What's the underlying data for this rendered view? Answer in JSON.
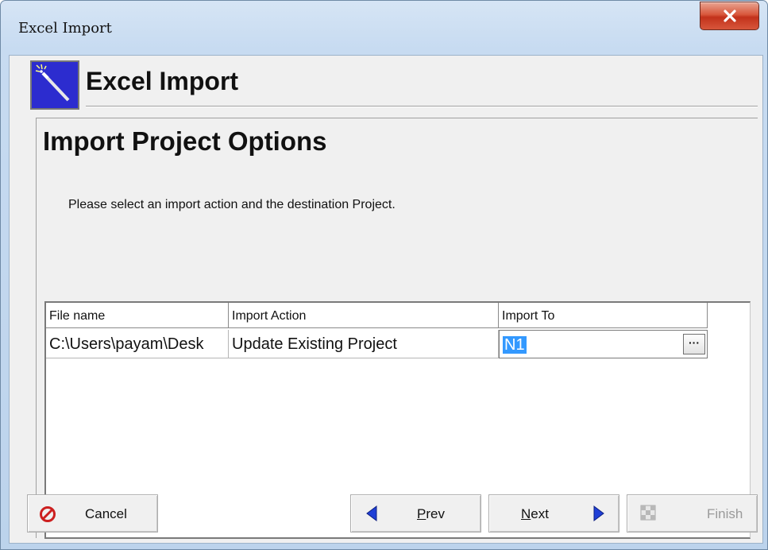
{
  "window": {
    "title": "Excel Import"
  },
  "header": {
    "title": "Excel Import",
    "icon": "magic-wand-icon"
  },
  "page": {
    "title": "Import Project Options",
    "instruction": "Please select an import action and the destination Project."
  },
  "grid": {
    "columns": [
      "File name",
      "Import Action",
      "Import To"
    ],
    "rows": [
      {
        "file_name": "C:\\Users\\payam\\Desk",
        "import_action": "Update Existing Project",
        "import_to": "N1",
        "browse_label": "···"
      }
    ]
  },
  "buttons": {
    "cancel": "Cancel",
    "prev_underlined": "P",
    "prev_rest": "rev",
    "next_underlined": "N",
    "next_rest": "ext",
    "finish": "Finish"
  },
  "colors": {
    "selection": "#3399ff",
    "wizard_icon_bg": "#2c2ccf",
    "cancel_icon": "#cc1f1f",
    "arrow": "#1f3fd6"
  }
}
